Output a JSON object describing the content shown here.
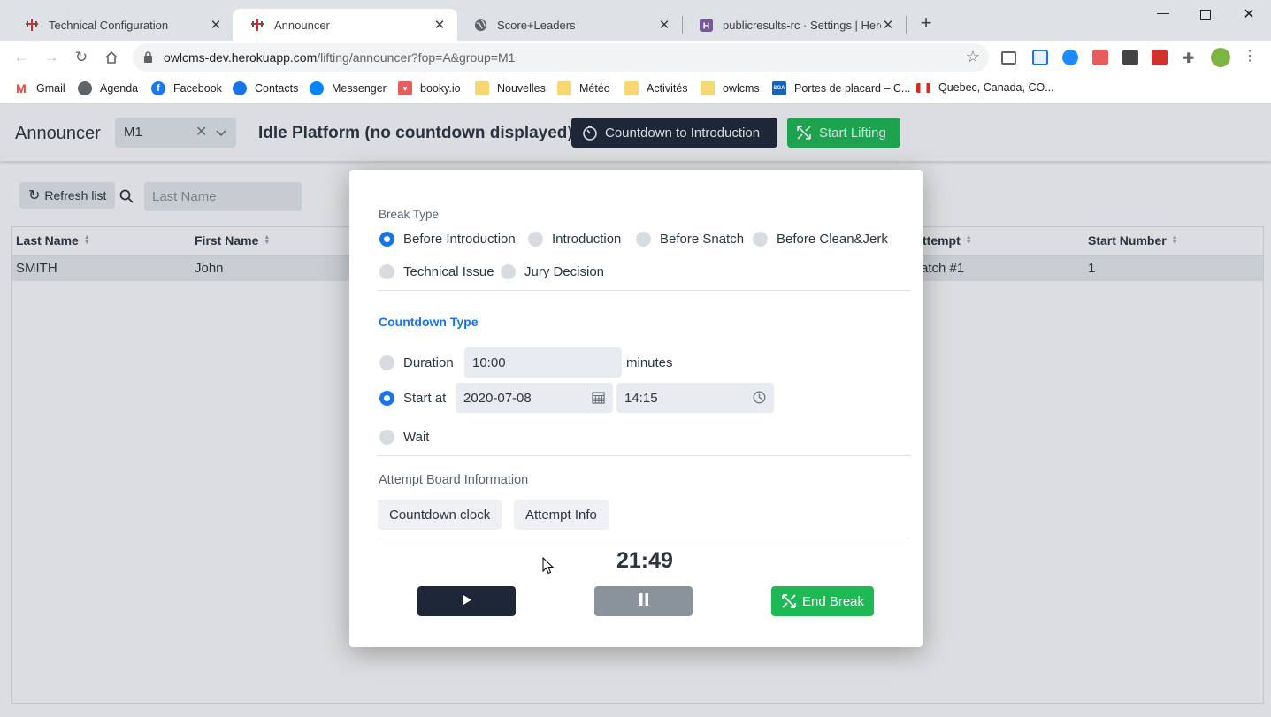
{
  "browser": {
    "tabs": [
      {
        "title": "Technical Configuration",
        "icon": "owlcms-icon",
        "active": false
      },
      {
        "title": "Announcer",
        "icon": "owlcms-icon",
        "active": true
      },
      {
        "title": "Score+Leaders",
        "icon": "globe-icon",
        "active": false
      },
      {
        "title": "publicresults-rc · Settings | Heroku",
        "icon": "heroku-icon",
        "active": false
      }
    ],
    "address": {
      "host": "owlcms-dev.herokuapp.com",
      "path": "/lifting/announcer?fop=A&group=M1"
    },
    "bookmarks": [
      {
        "label": "Gmail",
        "icon": "gmail-icon",
        "color": "#ea4335"
      },
      {
        "label": "Agenda",
        "icon": "globe-icon",
        "color": "#5f6368"
      },
      {
        "label": "Facebook",
        "icon": "facebook-icon",
        "color": "#1877f2"
      },
      {
        "label": "Contacts",
        "icon": "contacts-icon",
        "color": "#1a73e8"
      },
      {
        "label": "Messenger",
        "icon": "messenger-icon",
        "color": "#0084ff"
      },
      {
        "label": "booky.io",
        "icon": "booky-icon",
        "color": "#e85c5c"
      },
      {
        "label": "Nouvelles",
        "icon": "folder-icon",
        "color": "#f7d774"
      },
      {
        "label": "Météo",
        "icon": "folder-icon",
        "color": "#f7d774"
      },
      {
        "label": "Activités",
        "icon": "folder-icon",
        "color": "#f7d774"
      },
      {
        "label": "owlcms",
        "icon": "folder-icon",
        "color": "#f7d774"
      },
      {
        "label": "Portes de placard – C...",
        "icon": "sga-icon",
        "color": "#1565c0"
      },
      {
        "label": "Quebec, Canada, CO...",
        "icon": "canada-flag-icon",
        "color": "#d52b1e"
      }
    ]
  },
  "header": {
    "title": "Announcer",
    "group_value": "M1",
    "platform_state": "Idle Platform (no countdown displayed)",
    "countdown_button": "Countdown to Introduction",
    "start_button": "Start Lifting"
  },
  "toolbar": {
    "refresh_label": "Refresh list",
    "search_placeholder": "Last Name"
  },
  "grid": {
    "columns": [
      "Last Name",
      "First Name",
      "Attempt",
      "Start Number"
    ],
    "visible_columns": [
      "Last Name",
      "First Name",
      "ttempt",
      "Start Number"
    ],
    "rows": [
      {
        "last_name": "SMITH",
        "first_name": "John",
        "attempt": "atch #1",
        "start_number": "1"
      }
    ]
  },
  "dialog": {
    "break_type_label": "Break Type",
    "break_types": [
      {
        "label": "Before Introduction",
        "selected": true
      },
      {
        "label": "Introduction",
        "selected": false
      },
      {
        "label": "Before Snatch",
        "selected": false
      },
      {
        "label": "Before Clean&Jerk",
        "selected": false
      },
      {
        "label": "Technical Issue",
        "selected": false
      },
      {
        "label": "Jury Decision",
        "selected": false
      }
    ],
    "countdown_type_label": "Countdown Type",
    "duration_label": "Duration",
    "duration_value": "10:00",
    "minutes_label": "minutes",
    "start_at_label": "Start at",
    "start_date": "2020-07-08",
    "start_time": "14:15",
    "wait_label": "Wait",
    "countdown_selected": "start_at",
    "attempt_board_label": "Attempt Board Information",
    "countdown_clock_button": "Countdown clock",
    "attempt_info_button": "Attempt Info",
    "clock": "21:49",
    "end_break_button": "End Break"
  },
  "colors": {
    "accent_blue": "#1a73e8",
    "dark_button": "#1d2737",
    "green_button": "#1db954",
    "pause_grey": "#8a929c"
  }
}
